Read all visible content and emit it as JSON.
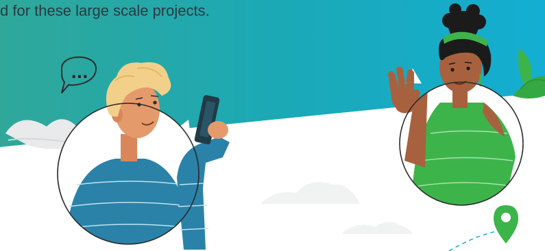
{
  "caption": "d for these large scale projects.",
  "speech_bubble_text": "...",
  "colors": {
    "banner_left": "#2fa89a",
    "banner_right": "#14aed2",
    "accent_green": "#3db44a",
    "shirt_blue": "#2b82a8",
    "shirt_green": "#3db44a",
    "skin_light": "#e59a6c",
    "skin_dark": "#a8613f",
    "hair_blonde": "#f3d08a",
    "hair_black": "#1b1b1b",
    "circle_outline": "#2b2b2b",
    "text": "#2a3a3f"
  },
  "icons": [
    "speech-bubble-icon",
    "location-pin-icon",
    "leaf-decoration-icon",
    "cloud-decoration-icon"
  ]
}
